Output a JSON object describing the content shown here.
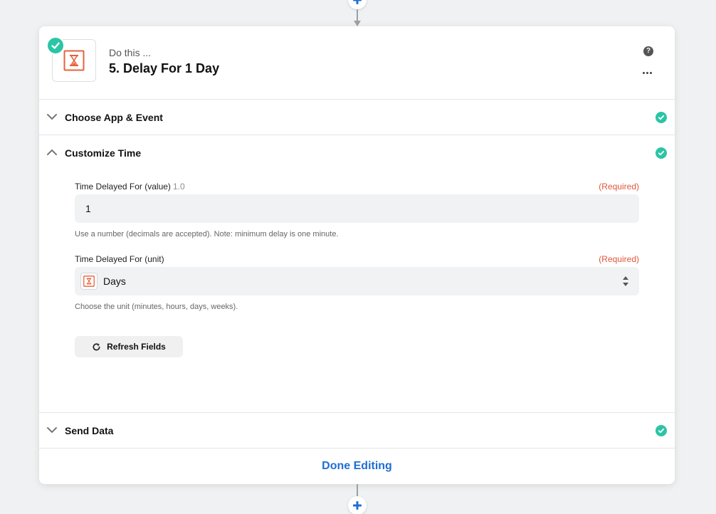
{
  "step": {
    "subtitle": "Do this ...",
    "title": "5. Delay For 1 Day",
    "help_glyph": "?"
  },
  "sections": {
    "choose_app": {
      "label": "Choose App & Event",
      "status": "complete"
    },
    "customize_time": {
      "label": "Customize Time",
      "status": "complete",
      "expanded": true
    },
    "send_data": {
      "label": "Send Data",
      "status": "complete"
    }
  },
  "fields": {
    "value": {
      "label": "Time Delayed For (value)",
      "hint": "1.0",
      "required": "(Required)",
      "value": "1",
      "help": "Use a number (decimals are accepted). Note: minimum delay is one minute."
    },
    "unit": {
      "label": "Time Delayed For (unit)",
      "required": "(Required)",
      "value": "Days",
      "help": "Choose the unit (minutes, hours, days, weeks)."
    }
  },
  "actions": {
    "refresh_label": "Refresh Fields",
    "done_label": "Done Editing"
  },
  "icons": {
    "app": "hourglass-icon",
    "status": "check-circle-icon",
    "add": "plus-icon",
    "refresh": "refresh-icon",
    "more": "ellipsis-icon",
    "help": "help-icon"
  },
  "colors": {
    "accent_blue": "#1f6ed4",
    "success": "#2bc5a5",
    "required": "#e0573b",
    "app_orange": "#e8613c"
  }
}
